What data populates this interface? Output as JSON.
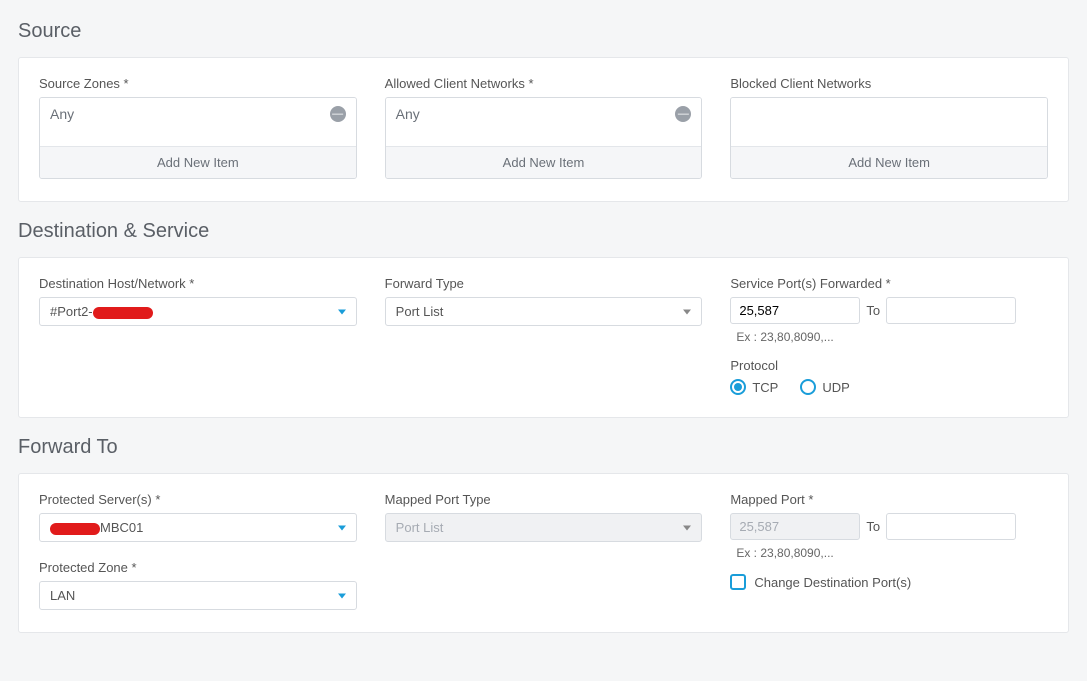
{
  "source": {
    "title": "Source",
    "zones": {
      "label": "Source Zones *",
      "value": "Any",
      "add": "Add New Item"
    },
    "allowed": {
      "label": "Allowed Client Networks *",
      "value": "Any",
      "add": "Add New Item"
    },
    "blocked": {
      "label": "Blocked Client Networks",
      "add": "Add New Item"
    }
  },
  "dest": {
    "title": "Destination & Service",
    "host": {
      "label": "Destination Host/Network *",
      "prefix": "#Port2-"
    },
    "fwdtype": {
      "label": "Forward Type",
      "value": "Port List"
    },
    "ports": {
      "label": "Service Port(s) Forwarded *",
      "from": "25,587",
      "to_label": "To",
      "to": "",
      "hint": "Ex : 23,80,8090,..."
    },
    "protocol": {
      "label": "Protocol",
      "tcp": "TCP",
      "udp": "UDP",
      "selected": "tcp"
    }
  },
  "fwd": {
    "title": "Forward To",
    "server": {
      "label": "Protected Server(s) *",
      "suffix": "MBC01"
    },
    "zone": {
      "label": "Protected Zone *",
      "value": "LAN"
    },
    "mappedtype": {
      "label": "Mapped Port Type",
      "value": "Port List"
    },
    "mappedport": {
      "label": "Mapped Port *",
      "from": "25,587",
      "to_label": "To",
      "to": "",
      "hint": "Ex : 23,80,8090,..."
    },
    "changeport": {
      "label": "Change Destination Port(s)"
    }
  }
}
